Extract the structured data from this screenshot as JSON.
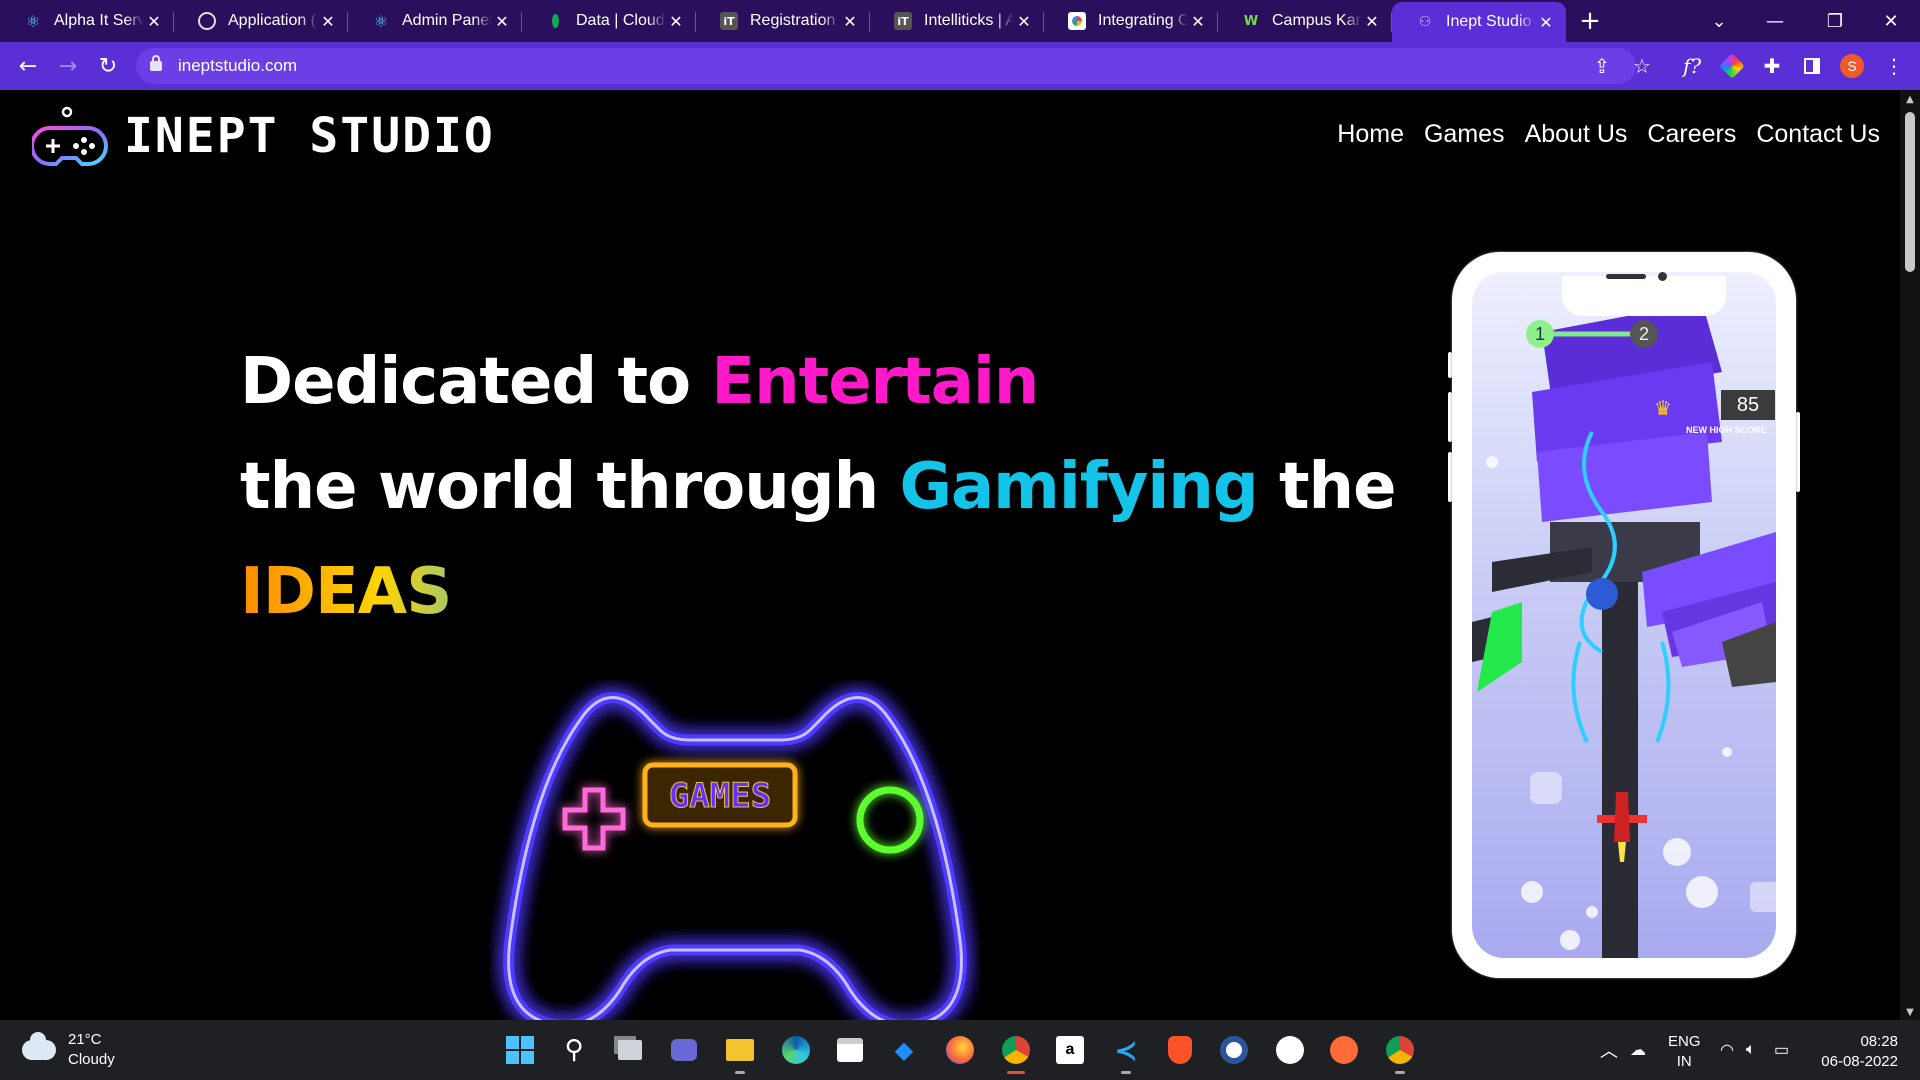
{
  "browser": {
    "tabs": [
      {
        "title": "Alpha It Servic",
        "icon": "react-icon"
      },
      {
        "title": "Application (7",
        "icon": "globe-icon"
      },
      {
        "title": "Admin Panel",
        "icon": "react-icon"
      },
      {
        "title": "Data | Cloud: M",
        "icon": "mongodb-leaf-icon"
      },
      {
        "title": "Registration –",
        "icon": "it-logo-icon"
      },
      {
        "title": "Intelliticks | Ac",
        "icon": "it-logo-icon"
      },
      {
        "title": "Integrating Go",
        "icon": "google-icon"
      },
      {
        "title": "Campus Kart",
        "icon": "campus-kart-icon"
      },
      {
        "title": "Inept Studio",
        "icon": "controller-icon",
        "active": true
      }
    ],
    "new_tab": "+",
    "url": "ineptstudio.com",
    "profile_initial": "S",
    "accent": "#5b2fd6",
    "tabstrip_color": "#2a0f5c"
  },
  "site": {
    "logo_text": "INEPT STUDIO",
    "nav": [
      "Home",
      "Games",
      "About Us",
      "Careers",
      "Contact Us"
    ],
    "hero": {
      "line1_a": "Dedicated to ",
      "line1_b": "Entertain",
      "line2_a": "the world through ",
      "line2_b": "Gamifying",
      "line2_c": " the",
      "line3": "IDEAS"
    },
    "controller_label": "GAMES",
    "phone": {
      "score": "85",
      "high_score_label": "NEW HIGH SCORE",
      "level_current": "1",
      "level_next": "2"
    }
  },
  "taskbar": {
    "weather_temp": "21°C",
    "weather_desc": "Cloudy",
    "lang_line1": "ENG",
    "lang_line2": "IN",
    "time": "08:28",
    "date": "06-08-2022"
  }
}
